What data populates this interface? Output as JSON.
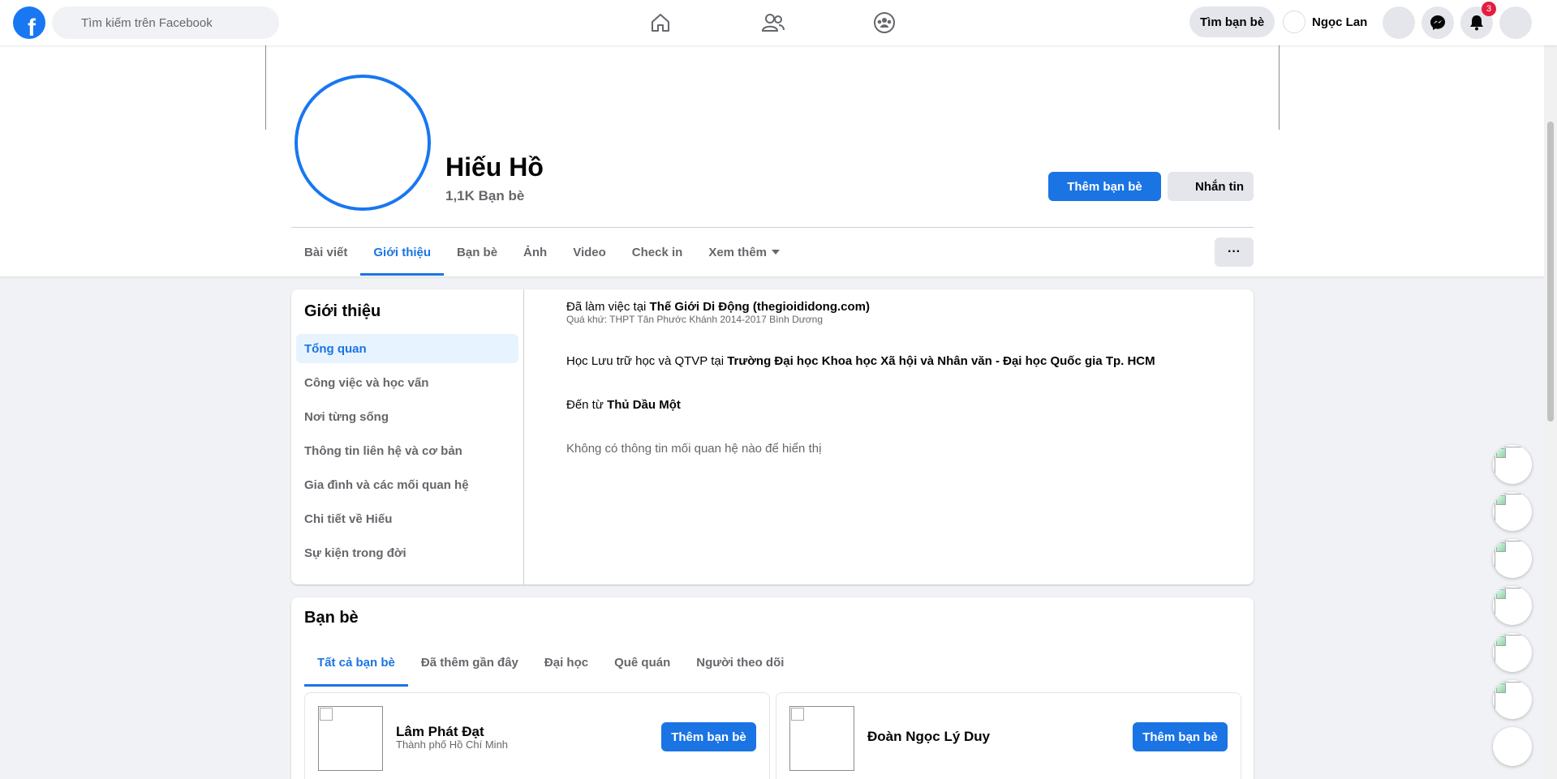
{
  "topbar": {
    "logo_letter": "f",
    "search_placeholder": "Tìm kiếm trên Facebook",
    "find_friends": "Tìm bạn bè",
    "user_name": "Ngọc Lan",
    "notification_count": "3"
  },
  "profile": {
    "name": "Hiếu Hồ",
    "friends_count": "1,1K Bạn bè",
    "add_friend": "Thêm bạn bè",
    "message": "Nhắn tin",
    "tabs": [
      "Bài viết",
      "Giới thiệu",
      "Bạn bè",
      "Ảnh",
      "Video",
      "Check in",
      "Xem thêm"
    ],
    "more": "···"
  },
  "about": {
    "title": "Giới thiệu",
    "menu": [
      "Tổng quan",
      "Công việc và học vấn",
      "Nơi từng sống",
      "Thông tin liên hệ và cơ bản",
      "Gia đình và các mối quan hệ",
      "Chi tiết về Hiếu",
      "Sự kiện trong đời"
    ],
    "work_prefix": "Đã làm việc tại ",
    "work_place": "Thế Giới Di Động (thegioididong.com)",
    "work_past": "Quá khứ: THPT Tân Phước Khánh 2014-2017 Bình Dương",
    "study_prefix": "Học Lưu trữ học và QTVP tại ",
    "study_place": "Trường Đại học Khoa học Xã hội và Nhân văn - Đại học Quốc gia Tp. HCM",
    "from_prefix": "Đến từ ",
    "from_place": "Thủ Dầu Một",
    "relationship": "Không có thông tin mối quan hệ nào để hiển thị"
  },
  "friends": {
    "title": "Bạn bè",
    "tabs": [
      "Tất cả bạn bè",
      "Đã thêm gần đây",
      "Đại học",
      "Quê quán",
      "Người theo dõi"
    ],
    "items": [
      {
        "name": "Lâm Phát Đạt",
        "location": "Thành phố Hồ Chí Minh",
        "button": "Thêm bạn bè"
      },
      {
        "name": "Đoàn Ngọc Lý Duy",
        "location": "",
        "button": "Thêm bạn bè"
      }
    ]
  },
  "colors": {
    "accent": "#1b74e4",
    "badge": "#e41e3f"
  }
}
